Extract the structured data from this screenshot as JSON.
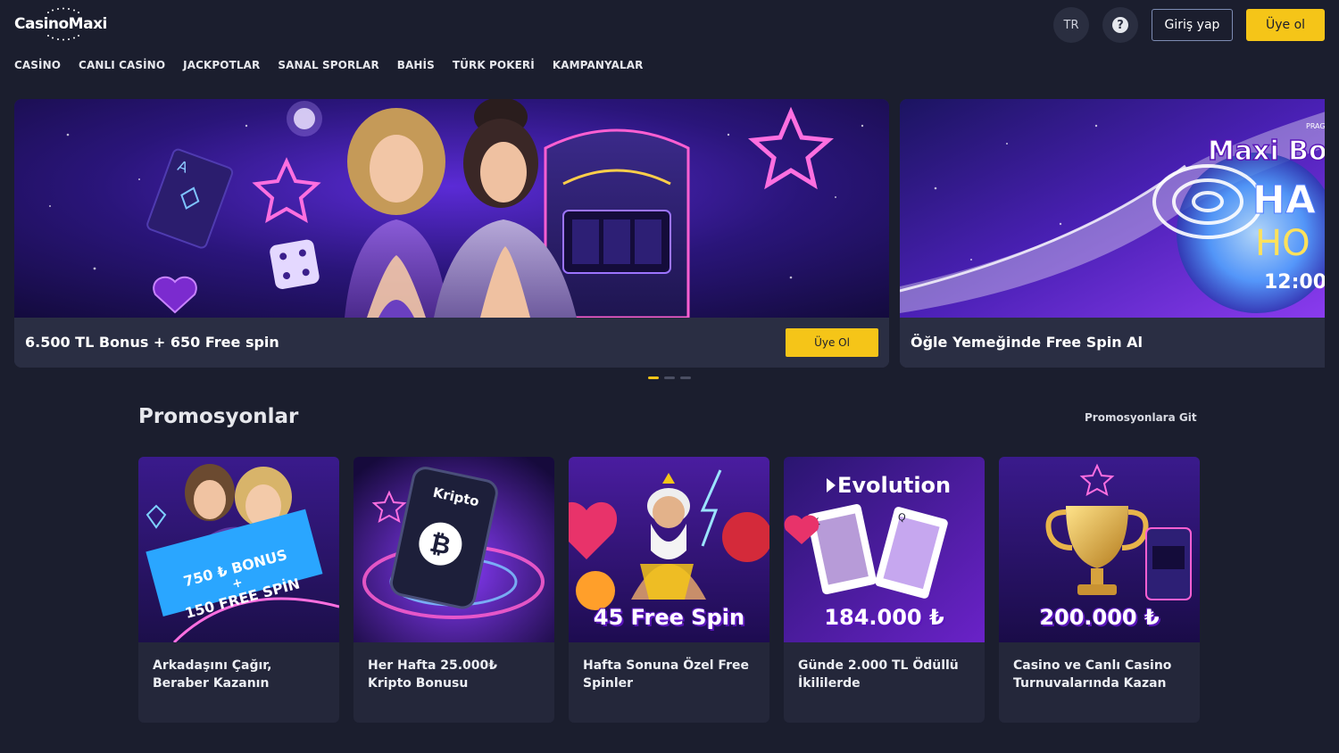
{
  "header": {
    "logo_text": "CasinoMaxi",
    "lang": "TR",
    "help_symbol": "?",
    "login_label": "Giriş yap",
    "signup_label": "Üye ol"
  },
  "nav": [
    "CASİNO",
    "CANLI CASİNO",
    "JACKPOTLAR",
    "SANAL SPORLAR",
    "BAHİS",
    "TÜRK POKERİ",
    "KAMPANYALAR"
  ],
  "slider": {
    "slides": [
      {
        "title": "6.500 TL Bonus + 650 Free spin",
        "cta": "Üye Ol"
      },
      {
        "title": "Öğle Yemeğinde Free Spin Al",
        "art_text_1": "Maxi Bon",
        "art_text_2": "HA",
        "art_text_3": "HO",
        "art_text_4": "12:00",
        "art_text_5": "PRAG"
      }
    ],
    "active_dot": 0,
    "dot_count": 3
  },
  "promotions": {
    "title": "Promosyonlar",
    "link": "Promosyonlara Git",
    "cards": [
      {
        "text": "Arkadaşını Çağır, Beraber Kazanın",
        "art_line_1": "750 ₺ BONUS",
        "art_line_2": "+",
        "art_line_3": "150 FREE SPİN"
      },
      {
        "text": "Her Hafta 25.000₺ Kripto Bonusu",
        "art_label": "Kripto",
        "art_symbol": "₿"
      },
      {
        "text": "Hafta Sonuna Özel Free Spinler",
        "art_overlay": "45 Free Spin"
      },
      {
        "text": "Günde 2.000 TL Ödüllü İkililerde",
        "art_brand": "Evolution",
        "art_overlay": "184.000 ₺"
      },
      {
        "text": "Casino ve Canlı Casino Turnuvalarında Kazan",
        "art_overlay": "200.000 ₺"
      }
    ]
  },
  "colors": {
    "background": "#1b1e2e",
    "accent_yellow": "#f5c518",
    "card_bg": "#24273a",
    "purple": "#5a16b8"
  },
  "icons": [
    "help-icon",
    "star-icon",
    "heart-icon",
    "dice-icon",
    "bitcoin-icon",
    "trophy-icon",
    "playing-card-icon"
  ]
}
